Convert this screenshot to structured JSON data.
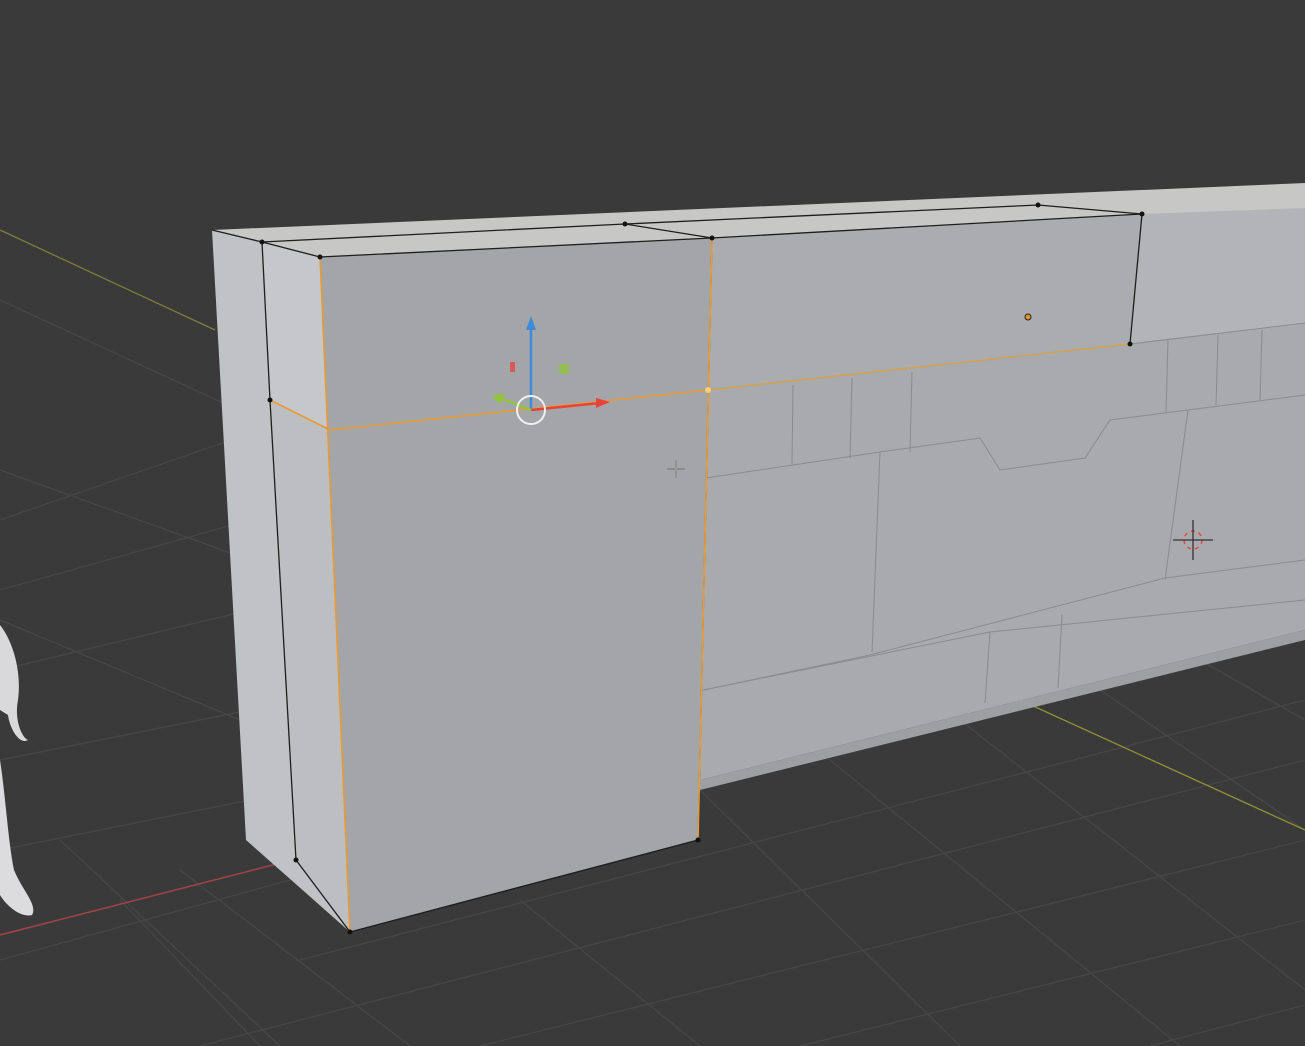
{
  "app": {
    "viewport_mode": "edit-mode",
    "object": "wall-mesh",
    "selected_elements": [
      "edge-loop"
    ],
    "tools": {
      "transform_gizmo": {
        "axes": [
          "x",
          "y",
          "z"
        ]
      },
      "cursor": "crosshair",
      "origin": "pivot"
    }
  },
  "colors": {
    "background": "#3a3a3a",
    "grid_line": "#4a4a4a",
    "x_axis": "#b04b4b",
    "y_axis": "#a6b03a",
    "mesh_light": "#c9c9cb",
    "mesh_front": "#a7a8ab",
    "mesh_side": "#b7b8bb",
    "mesh_top": "#bfc0c2",
    "edge": "#2a2a2a",
    "selected_edge": "#f0a030",
    "gizmo_x": "#e8423d",
    "gizmo_y": "#92c63a",
    "gizmo_z": "#3d8bd9"
  }
}
